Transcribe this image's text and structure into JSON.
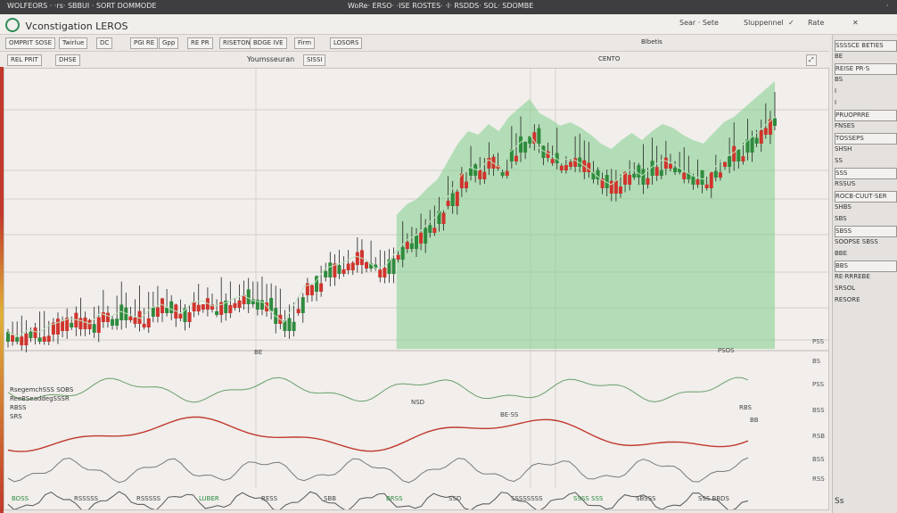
{
  "window": {
    "title_left": "WOLFEORS · ·rs· SBBUI · SORT DOMMODE",
    "title_center": "WoRe· ERSO· ·ISE ROSTES· ·I· RSDDS· SOL· SDOMBE",
    "title_right": "·"
  },
  "menubar": {
    "brand": "Vconstigation LEROS",
    "items": [
      "Sear · Sete",
      "Sluppennel",
      "✓",
      "Rate",
      "✕"
    ]
  },
  "toolbar": {
    "buttons": [
      "OMPRIT SOSE",
      "Twirlue",
      "DC",
      "PGI RE",
      "Gpp",
      "RE PR",
      "RISETON",
      "BDGE IVE",
      "Firm",
      "LOSORS"
    ],
    "right_label": "Blbetis"
  },
  "subbar": {
    "left_buttons": [
      "REL PRIT",
      "DHSE"
    ],
    "center_title": "Youmsseuran",
    "center_badge": "SISSI",
    "right_label": "CENTO"
  },
  "right_panel": {
    "items": [
      "SSSSCE BETIES",
      "BE",
      "REISE PR·S",
      "BS",
      "I",
      "I",
      "PRUOPRRE",
      "FNSES",
      "TOSSEPS",
      "SHSH",
      "SS",
      "SSS",
      "RSSUS",
      "ROCB·CUUT·SER",
      "SHBS",
      "SBS",
      "SBSS",
      "SOOPSE SBSS",
      "BBE",
      "BBS",
      "RE·RRREBE",
      "SRSOL",
      "RESORE"
    ],
    "bottom_logo": "Ss"
  },
  "chart": {
    "price_labels": [
      "PSS",
      "BS",
      "PSS",
      "BSS",
      "RSB",
      "BSS",
      "RSS"
    ],
    "indicator_legend": [
      "RsegemchSSS SOBS",
      "ReeBSeaddegSSSR",
      "RBSS",
      "SRS"
    ],
    "bottom_labels": [
      "BOSS",
      "RSSSSS",
      "RSSSSS",
      "LUBER",
      "RESS",
      "SBB",
      "BRSS",
      "SSD",
      "SSSSSSSS",
      "SSSS SSS",
      "SBSSS",
      "SSS BBDS"
    ],
    "mid_labels": [
      "BE",
      "NSD",
      "BE·SS",
      "PSOS",
      "RBS",
      "BB"
    ],
    "up_color": "#2e8b3d",
    "down_color": "#d0342c",
    "fill_color": "#7fd08a"
  },
  "chart_data": {
    "type": "line",
    "title": "",
    "xlabel": "",
    "ylabel": "",
    "series": [
      {
        "values": [
          372,
          376,
          368,
          372,
          364,
          360,
          356,
          358,
          362,
          350,
          354,
          348,
          352,
          356,
          344,
          340,
          346,
          350,
          338,
          336,
          342,
          340,
          334,
          330,
          336,
          338,
          352,
          360,
          340,
          320,
          316,
          300,
          296,
          292,
          286,
          290,
          300,
          296,
          280,
          268,
          262,
          250,
          240,
          220,
          200,
          186,
          190,
          178,
          186,
          170,
          160,
          150,
          166,
          172,
          180,
          176,
          182,
          190,
          200,
          206,
          196,
          188,
          196,
          186,
          178,
          182,
          190,
          196,
          200,
          188,
          176,
          170,
          160,
          150,
          140,
          130
        ]
      }
    ]
  }
}
